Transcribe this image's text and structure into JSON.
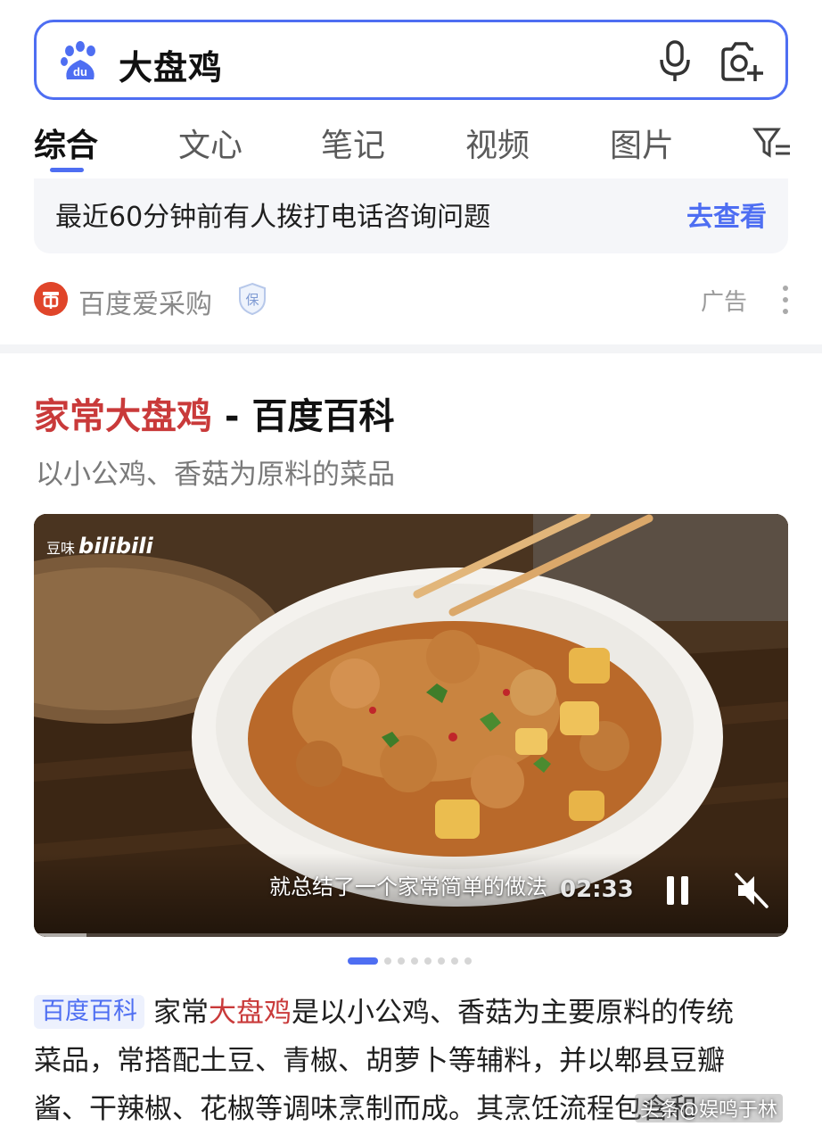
{
  "search": {
    "query": "大盘鸡",
    "logo_icon": "baidu-paw-logo",
    "voice_icon": "microphone-icon",
    "camera_icon": "camera-search-icon"
  },
  "tabs": [
    {
      "label": "综合",
      "active": true
    },
    {
      "label": "文心",
      "active": false
    },
    {
      "label": "笔记",
      "active": false
    },
    {
      "label": "视频",
      "active": false
    },
    {
      "label": "图片",
      "active": false
    }
  ],
  "notice": {
    "text": "最近60分钟前有人拨打电话咨询问题",
    "link": "去查看"
  },
  "ad": {
    "brand": "百度爱采购",
    "label": "广告"
  },
  "result": {
    "title_highlight": "家常大盘鸡",
    "title_rest": " - 百度百科",
    "subtitle": "以小公鸡、香菇为原料的菜品",
    "video": {
      "watermark_text": "豆味",
      "watermark_brand": "bilibili",
      "caption": "就总结了一个家常简单的做法",
      "duration": "02:33"
    },
    "carousel_count": 8,
    "carousel_active": 0,
    "description": {
      "tag": "百度百科",
      "p1": "家常",
      "p1_hl": "大盘鸡",
      "p1_rest": "是以小公鸡、香菇为主要原料的传统",
      "line2": "菜品，常搭配土豆、青椒、胡萝卜等辅料，并以郫县豆瓣",
      "line3": "酱、干辣椒、花椒等调味烹制而成。其烹饪流程包含和"
    },
    "credit": "头条@娱鸣于林"
  },
  "colors": {
    "accent": "#4e6ef2",
    "highlight": "#c93a3a"
  }
}
